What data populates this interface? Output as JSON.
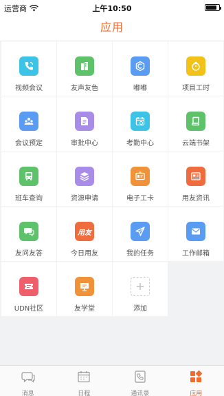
{
  "status_bar": {
    "carrier": "运营商",
    "time": "上午10:50",
    "battery_level": 0.85
  },
  "nav": {
    "title": "应用"
  },
  "apps": [
    {
      "name": "video-conference",
      "label": "视频会议",
      "color": "#3dc3e6",
      "icon": "phone-icon"
    },
    {
      "name": "friends-voice",
      "label": "友声友色",
      "color": "#5ec26a",
      "icon": "building-icon"
    },
    {
      "name": "dudu",
      "label": "嘟嘟",
      "color": "#5a9cf2",
      "icon": "hexagon-c-icon"
    },
    {
      "name": "project-hours",
      "label": "项目工时",
      "color": "#f3c21a",
      "icon": "timer-icon"
    },
    {
      "name": "meeting-booking",
      "label": "会议预定",
      "color": "#5a9cf2",
      "icon": "people-icon"
    },
    {
      "name": "approval-center",
      "label": "审批中心",
      "color": "#a98ce8",
      "icon": "document-icon"
    },
    {
      "name": "attendance-center",
      "label": "考勤中心",
      "color": "#3dc3e6",
      "icon": "calendar-clock-icon"
    },
    {
      "name": "cloud-bookshelf",
      "label": "云端书架",
      "color": "#5ec26a",
      "icon": "book-icon"
    },
    {
      "name": "shuttle-query",
      "label": "班车查询",
      "color": "#5ec26a",
      "icon": "bus-icon"
    },
    {
      "name": "resource-request",
      "label": "资源申请",
      "color": "#a98ce8",
      "icon": "layers-icon"
    },
    {
      "name": "e-badge",
      "label": "电子工卡",
      "color": "#f0923a",
      "icon": "id-card-icon"
    },
    {
      "name": "yonyou-news",
      "label": "用友资讯",
      "color": "#ef6c3e",
      "icon": "news-icon"
    },
    {
      "name": "friends-qa",
      "label": "友问友答",
      "color": "#5ec26a",
      "icon": "chat-icon"
    },
    {
      "name": "today-yonyou",
      "label": "今日用友",
      "color": "#ef6c3e",
      "icon": "yonyou-logo-icon",
      "icon_text": "用友"
    },
    {
      "name": "my-tasks",
      "label": "我的任务",
      "color": "#5a9cf2",
      "icon": "send-icon"
    },
    {
      "name": "work-mail",
      "label": "工作邮箱",
      "color": "#5a9cf2",
      "icon": "mail-icon"
    },
    {
      "name": "udn-community",
      "label": "UDN社区",
      "color": "#ef5f6b",
      "icon": "ticket-icon"
    },
    {
      "name": "friends-school",
      "label": "友学堂",
      "color": "#f0923a",
      "icon": "presentation-icon"
    },
    {
      "name": "add",
      "label": "添加",
      "color": "#ffffff",
      "icon": "plus-icon"
    }
  ],
  "tabs": [
    {
      "name": "messages",
      "label": "消息",
      "icon": "chat-bubble-icon",
      "active": false
    },
    {
      "name": "schedule",
      "label": "日程",
      "icon": "calendar-icon",
      "active": false
    },
    {
      "name": "contacts",
      "label": "通讯录",
      "icon": "contact-book-icon",
      "active": false
    },
    {
      "name": "apps",
      "label": "应用",
      "icon": "apps-grid-icon",
      "active": true
    }
  ],
  "colors": {
    "accent": "#ef6c2e",
    "inactive": "#888888"
  }
}
